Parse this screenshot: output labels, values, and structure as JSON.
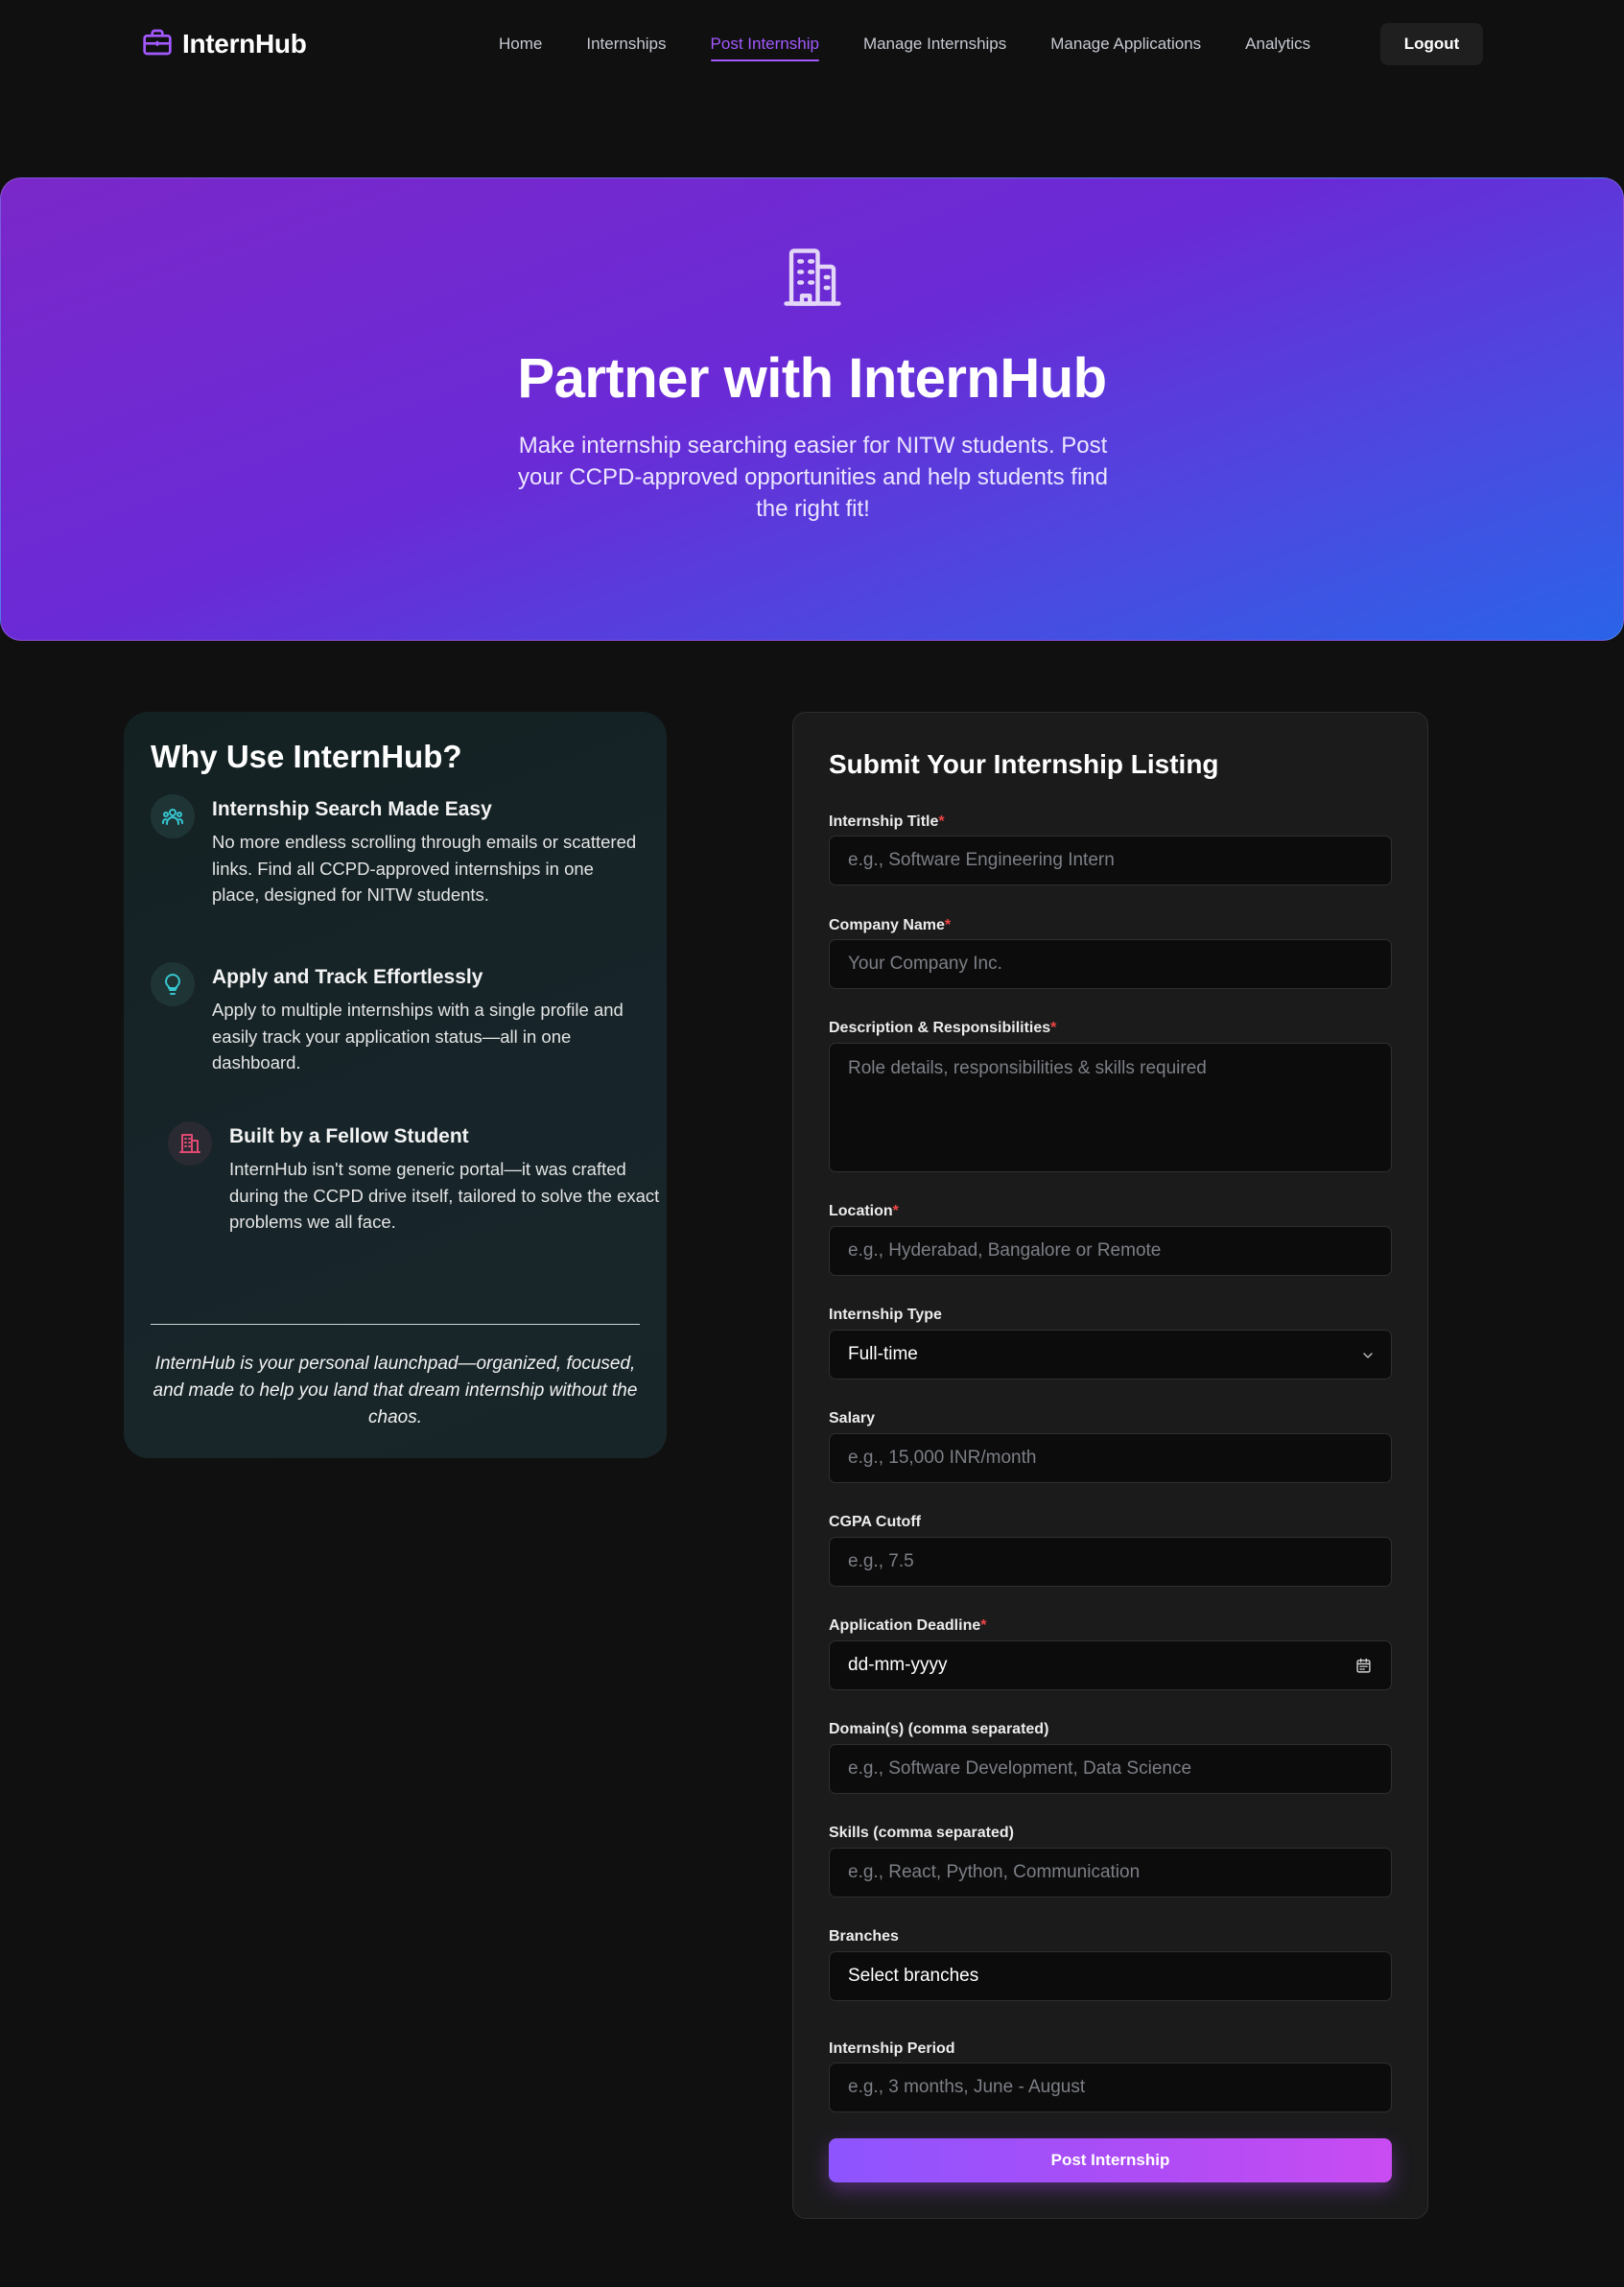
{
  "brand": {
    "name": "InternHub"
  },
  "nav": {
    "links": [
      "Home",
      "Internships",
      "Post Internship",
      "Manage Internships",
      "Manage Applications",
      "Analytics"
    ],
    "active": "Post Internship",
    "logout": "Logout"
  },
  "hero": {
    "title": "Partner with InternHub",
    "subtitle": "Make internship searching easier for NITW students. Post your CCPD-approved opportunities and help students find the right fit!"
  },
  "why": {
    "title": "Why Use InternHub?",
    "features": [
      {
        "title": "Internship Search Made Easy",
        "text": "No more endless scrolling through emails or scattered links. Find all CCPD-approved internships in one place, designed for NITW students.",
        "icon": "users-icon"
      },
      {
        "title": "Apply and Track Effortlessly",
        "text": "Apply to multiple internships with a single profile and easily track your application status—all in one dashboard.",
        "icon": "lightbulb-icon"
      },
      {
        "title": "Built by a Fellow Student",
        "text": "InternHub isn't some generic portal—it was crafted during the CCPD drive itself, tailored to solve the exact problems we all face.",
        "icon": "building-icon"
      }
    ],
    "quote": "InternHub is your personal launchpad—organized, focused, and made to help you land that dream internship without the chaos."
  },
  "form": {
    "title": "Submit Your Internship Listing",
    "fields": {
      "title": {
        "label": "Internship Title",
        "placeholder": "e.g., Software Engineering Intern"
      },
      "company": {
        "label": "Company Name",
        "placeholder": "Your Company Inc."
      },
      "description": {
        "label": "Description & Responsibilities",
        "placeholder": "Role details, responsibilities & skills required"
      },
      "location": {
        "label": "Location",
        "placeholder": "e.g., Hyderabad, Bangalore or Remote"
      },
      "type": {
        "label": "Internship Type",
        "value": "Full-time"
      },
      "salary": {
        "label": "Salary",
        "placeholder": "e.g., 15,000 INR/month"
      },
      "cgpa": {
        "label": "CGPA Cutoff",
        "placeholder": "e.g., 7.5"
      },
      "deadline": {
        "label": "Application Deadline",
        "value": "dd-mm-yyyy"
      },
      "domains": {
        "label": "Domain(s) (comma separated)",
        "placeholder": "e.g., Software Development, Data Science"
      },
      "skills": {
        "label": "Skills (comma separated)",
        "placeholder": "e.g., React, Python, Communication"
      },
      "branches": {
        "label": "Branches",
        "value": "Select branches"
      },
      "period": {
        "label": "Internship Period",
        "placeholder": "e.g., 3 months, June - August"
      }
    },
    "required_mark": "*",
    "submit": "Post Internship"
  },
  "colors": {
    "accent": "#a259ff",
    "background": "#101010",
    "hero_gradient_start": "#7a28c9",
    "hero_gradient_end": "#2a63e8",
    "required": "#ef4444"
  }
}
